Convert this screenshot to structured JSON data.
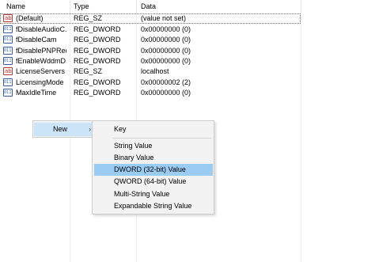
{
  "columns": {
    "name": "Name",
    "type": "Type",
    "data": "Data"
  },
  "rows": [
    {
      "name": "(Default)",
      "type": "REG_SZ",
      "data": "(value not set)",
      "icon": "string-value-icon"
    },
    {
      "name": "fDisableAudioC...",
      "type": "REG_DWORD",
      "data": "0x00000000 (0)",
      "icon": "binary-value-icon"
    },
    {
      "name": "fDisableCam",
      "type": "REG_DWORD",
      "data": "0x00000000 (0)",
      "icon": "binary-value-icon"
    },
    {
      "name": "fDisablePNPRedir",
      "type": "REG_DWORD",
      "data": "0x00000000 (0)",
      "icon": "binary-value-icon"
    },
    {
      "name": "fEnableWddmD...",
      "type": "REG_DWORD",
      "data": "0x00000000 (0)",
      "icon": "binary-value-icon"
    },
    {
      "name": "LicenseServers",
      "type": "REG_SZ",
      "data": "localhost",
      "icon": "string-value-icon"
    },
    {
      "name": "LicensingMode",
      "type": "REG_DWORD",
      "data": "0x00000002 (2)",
      "icon": "binary-value-icon"
    },
    {
      "name": "MaxIdleTime",
      "type": "REG_DWORD",
      "data": "0x00000000 (0)",
      "icon": "binary-value-icon"
    }
  ],
  "context_menu": {
    "new_label": "New",
    "arrow": "›"
  },
  "submenu": {
    "key": "Key",
    "string_value": "String Value",
    "binary_value": "Binary Value",
    "dword_value": "DWORD (32-bit) Value",
    "qword_value": "QWORD (64-bit) Value",
    "multi_string_value": "Multi-String Value",
    "expandable_string_value": "Expandable String Value",
    "highlighted": "DWORD (32-bit) Value"
  },
  "colors": {
    "menu_bg": "#f2f2f2",
    "menu_highlight": "#99cbf3",
    "new_highlight": "#cce4f7"
  }
}
